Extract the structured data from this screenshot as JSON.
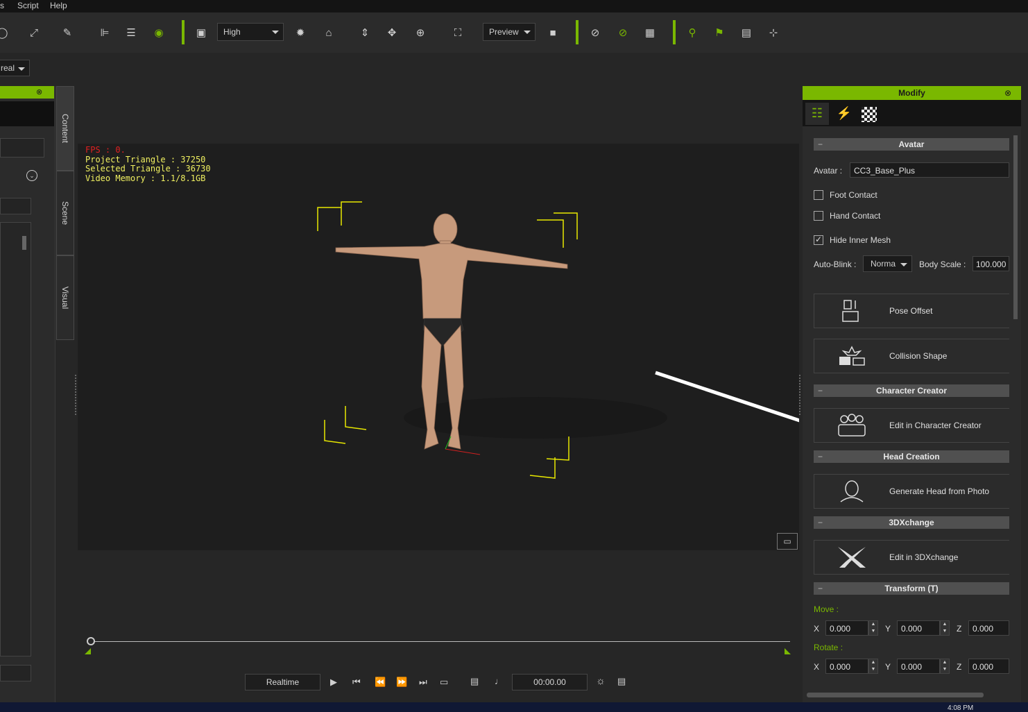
{
  "menubar": {
    "items": [
      "s",
      "Script",
      "Help"
    ]
  },
  "toolbar": {
    "quality_select": "High",
    "preview_select": "Preview",
    "left_select": "real"
  },
  "left_tabs": [
    "Content",
    "Scene",
    "Visual"
  ],
  "viewport": {
    "fps": "FPS : 0.",
    "project_triangle": "Project Triangle : 37250",
    "selected_triangle": "Selected Triangle : 36730",
    "video_memory": "Video Memory : 1.1/8.1GB"
  },
  "modify": {
    "title": "Modify",
    "avatar_section": "Avatar",
    "avatar_label": "Avatar :",
    "avatar_value": "CC3_Base_Plus",
    "foot_contact": "Foot Contact",
    "hand_contact": "Hand Contact",
    "hide_inner_mesh": "Hide Inner Mesh",
    "hide_inner_mesh_checked": true,
    "auto_blink_label": "Auto-Blink :",
    "auto_blink_value": "Norma",
    "body_scale_label": "Body Scale :",
    "body_scale_value": "100.000",
    "pose_offset": "Pose Offset",
    "collision_shape": "Collision Shape",
    "cc_section": "Character Creator",
    "edit_in_cc": "Edit in Character Creator",
    "head_section": "Head Creation",
    "generate_head": "Generate Head from Photo",
    "xchange_section": "3DXchange",
    "edit_in_3dx": "Edit in 3DXchange",
    "transform_section": "Transform  (T)",
    "move_label": "Move :",
    "rotate_label": "Rotate :",
    "axis_x": "X",
    "axis_y": "Y",
    "axis_z": "Z",
    "move": {
      "x": "0.000",
      "y": "0.000",
      "z": "0.000"
    },
    "rotate": {
      "x": "0.000",
      "y": "0.000",
      "z": "0.000"
    }
  },
  "playback": {
    "mode": "Realtime",
    "time": "00:00.00"
  },
  "taskbar": {
    "clock": "4:08 PM"
  },
  "colors": {
    "accent": "#7ab800",
    "panel": "#2b2b2b",
    "viewport": "#1e1e1e"
  }
}
